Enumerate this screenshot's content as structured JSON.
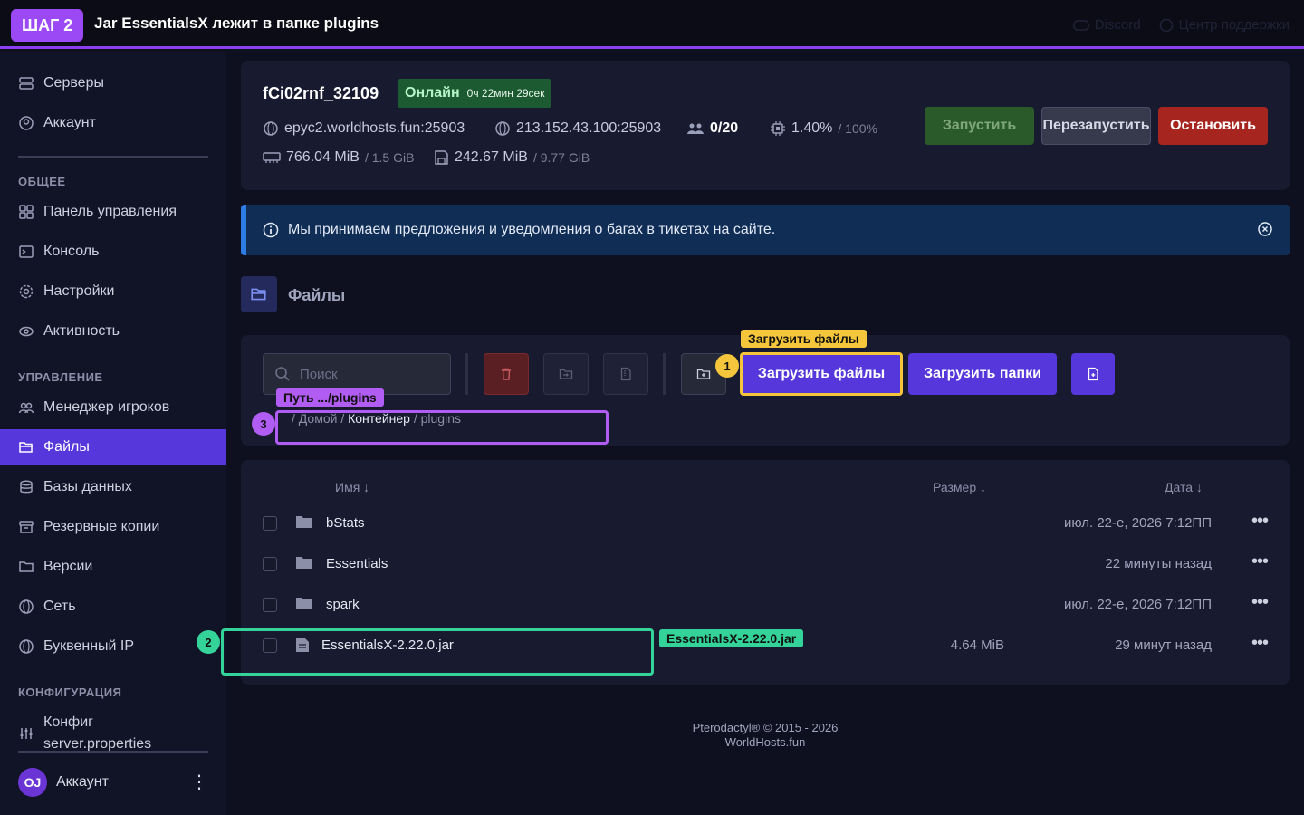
{
  "topbar": {
    "step": "ШАГ 2",
    "title": "Jar EssentialsX лежит в папке plugins",
    "discord": "Discord",
    "support": "Центр поддержки"
  },
  "sidebar": {
    "top_items": [
      {
        "label": "Серверы",
        "icon": "server-icon"
      },
      {
        "label": "Аккаунт",
        "icon": "user-circle-icon"
      }
    ],
    "section_general": "ОБЩЕЕ",
    "general_items": [
      {
        "label": "Панель управления",
        "icon": "grid-icon"
      },
      {
        "label": "Консоль",
        "icon": "terminal-icon"
      },
      {
        "label": "Настройки",
        "icon": "gear-icon"
      },
      {
        "label": "Активность",
        "icon": "eye-icon"
      }
    ],
    "section_manage": "УПРАВЛЕНИЕ",
    "manage_items": [
      {
        "label": "Менеджер игроков",
        "icon": "users-icon"
      },
      {
        "label": "Файлы",
        "icon": "folder-open-icon",
        "active": true
      },
      {
        "label": "Базы данных",
        "icon": "database-icon"
      },
      {
        "label": "Резервные копии",
        "icon": "archive-icon"
      },
      {
        "label": "Версии",
        "icon": "folder-icon"
      },
      {
        "label": "Сеть",
        "icon": "globe-icon"
      },
      {
        "label": "Буквенный IP",
        "icon": "globe-icon"
      }
    ],
    "section_config": "КОНФИГУРАЦИЯ",
    "config_item": "Конфиг server.properties",
    "account": {
      "initials": "OJ",
      "name": "Аккаунт"
    }
  },
  "server": {
    "name": "fCi02rnf_32109",
    "status": "Онлайн",
    "uptime": "0ч 22мин 29сек",
    "address": "epyc2.worldhosts.fun:25903",
    "ip": "213.152.43.100:25903",
    "players": "0/20",
    "cpu": "1.40%",
    "cpu_limit": "/ 100%",
    "memory": "766.04 MiB",
    "memory_limit": "/ 1.5 GiB",
    "disk": "242.67 MiB",
    "disk_limit": "/ 9.77 GiB",
    "buttons": {
      "start": "Запустить",
      "restart": "Перезапустить",
      "stop": "Остановить"
    }
  },
  "notice": "Мы принимаем предложения и уведомления о багах в тикетах на сайте.",
  "files": {
    "title": "Файлы",
    "search_placeholder": "Поиск",
    "upload_files": "Загрузить файлы",
    "upload_folders": "Загрузить папки",
    "breadcrumbs": {
      "sep": "/",
      "home": "Домой",
      "container": "Контейнер",
      "current": "plugins"
    },
    "columns": {
      "name": "Имя ↓",
      "size": "Размер ↓",
      "date": "Дата ↓"
    },
    "rows": [
      {
        "name": "bStats",
        "type": "folder",
        "size": "",
        "date": "июл. 22-е, 2026 7:12ПП"
      },
      {
        "name": "Essentials",
        "type": "folder",
        "size": "",
        "date": "22 минуты назад"
      },
      {
        "name": "spark",
        "type": "folder",
        "size": "",
        "date": "июл. 22-е, 2026 7:12ПП"
      },
      {
        "name": "EssentialsX-2.22.0.jar",
        "type": "file",
        "size": "4.64 MiB",
        "date": "29 минут назад"
      }
    ]
  },
  "annotations": {
    "a1": {
      "num": "1",
      "tag": "Загрузить файлы",
      "color": "#f5c63b"
    },
    "a2": {
      "num": "2",
      "tag": "EssentialsX-2.22.0.jar",
      "color": "#34d39a"
    },
    "a3": {
      "num": "3",
      "tag": "Путь .../plugins",
      "color": "#b15cf2"
    }
  },
  "footer": {
    "line1": "Pterodactyl® © 2015 - 2026",
    "line2": "WorldHosts.fun"
  }
}
